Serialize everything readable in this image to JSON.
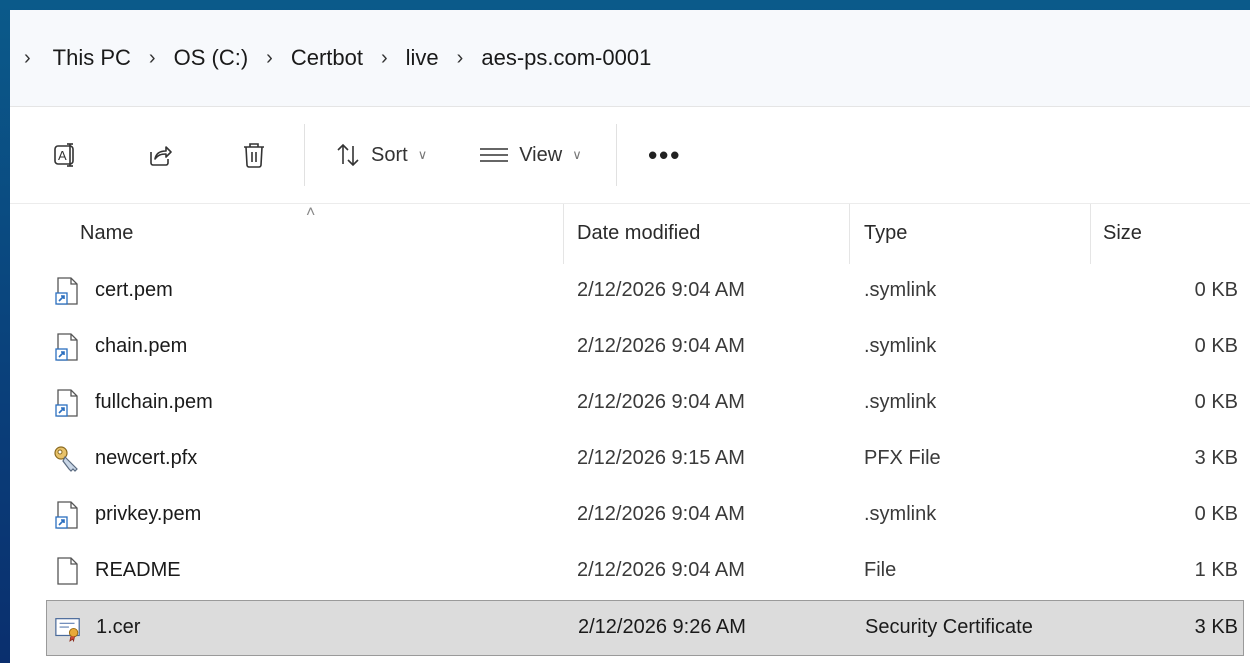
{
  "breadcrumb": {
    "items": [
      "This PC",
      "OS (C:)",
      "Certbot",
      "live",
      "aes-ps.com-0001"
    ]
  },
  "toolbar": {
    "rename_icon": "rename-icon",
    "share_icon": "share-icon",
    "delete_icon": "delete-icon",
    "sort_label": "Sort",
    "view_label": "View",
    "more_label": "•••"
  },
  "columns": {
    "name": "Name",
    "date": "Date modified",
    "type": "Type",
    "size": "Size"
  },
  "files": [
    {
      "name": "cert.pem",
      "date": "2/12/2026 9:04 AM",
      "type": ".symlink",
      "size": "0 KB",
      "icon": "symlink-file-icon"
    },
    {
      "name": "chain.pem",
      "date": "2/12/2026 9:04 AM",
      "type": ".symlink",
      "size": "0 KB",
      "icon": "symlink-file-icon"
    },
    {
      "name": "fullchain.pem",
      "date": "2/12/2026 9:04 AM",
      "type": ".symlink",
      "size": "0 KB",
      "icon": "symlink-file-icon"
    },
    {
      "name": "newcert.pfx",
      "date": "2/12/2026 9:15 AM",
      "type": "PFX File",
      "size": "3 KB",
      "icon": "pfx-key-icon"
    },
    {
      "name": "privkey.pem",
      "date": "2/12/2026 9:04 AM",
      "type": ".symlink",
      "size": "0 KB",
      "icon": "symlink-file-icon"
    },
    {
      "name": "README",
      "date": "2/12/2026 9:04 AM",
      "type": "File",
      "size": "1 KB",
      "icon": "blank-file-icon"
    },
    {
      "name": "1.cer",
      "date": "2/12/2026 9:26 AM",
      "type": "Security Certificate",
      "size": "3 KB",
      "icon": "certificate-icon",
      "selected": true
    }
  ],
  "colors": {
    "desktop_bg": "#0a3f7a",
    "selection_bg": "#dcdcdc",
    "selection_border": "#9a9a9a"
  }
}
